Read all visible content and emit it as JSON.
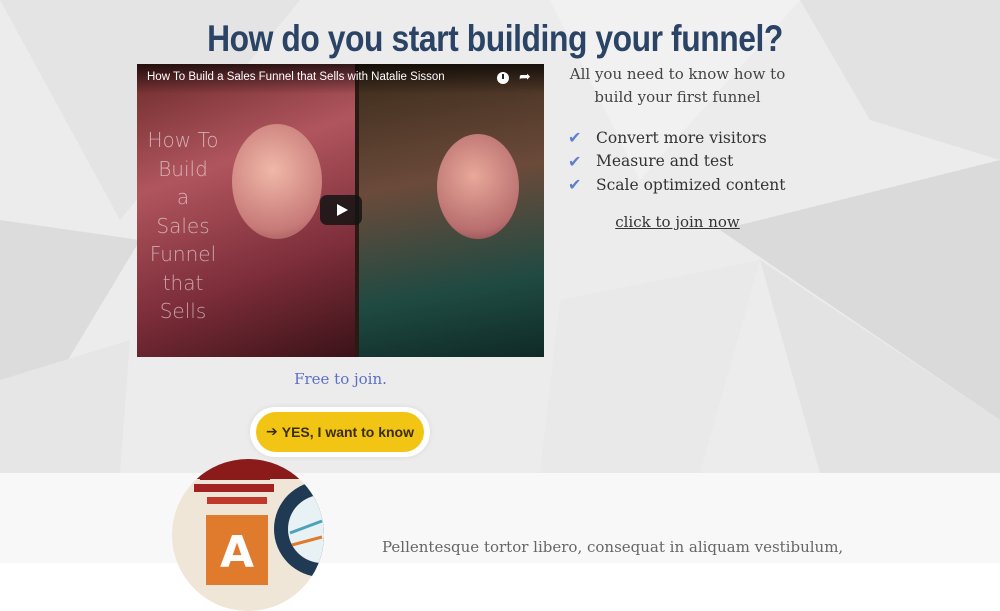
{
  "header": {
    "title": "How do you start building your funnel?"
  },
  "video": {
    "title": "How To Build a Sales Funnel that Sells with Natalie Sisson",
    "overlay_lines": [
      "How To",
      "Build",
      "a",
      "Sales",
      "Funnel",
      "that Sells"
    ],
    "icons": {
      "watch_later": "clock-icon",
      "share": "share-arrow-icon",
      "play": "play-icon"
    }
  },
  "signup": {
    "free_text": "Free to join.",
    "cta_label": "YES, I want to know",
    "cta_icon": "arrow-right-icon",
    "cta_color": "#f2c413"
  },
  "aside": {
    "intro": "All you need to know how to build your first funnel",
    "benefits": [
      "Convert more visitors",
      "Measure and test",
      "Scale optimized content"
    ],
    "benefit_icon": "check-icon",
    "join_link": "click to join now"
  },
  "lower": {
    "text": "Pellentesque tortor libero, consequat in aliquam vestibulum,"
  },
  "colors": {
    "title": "#2b4466",
    "accent": "#5e80c9",
    "free_text": "#5b6fc7"
  }
}
